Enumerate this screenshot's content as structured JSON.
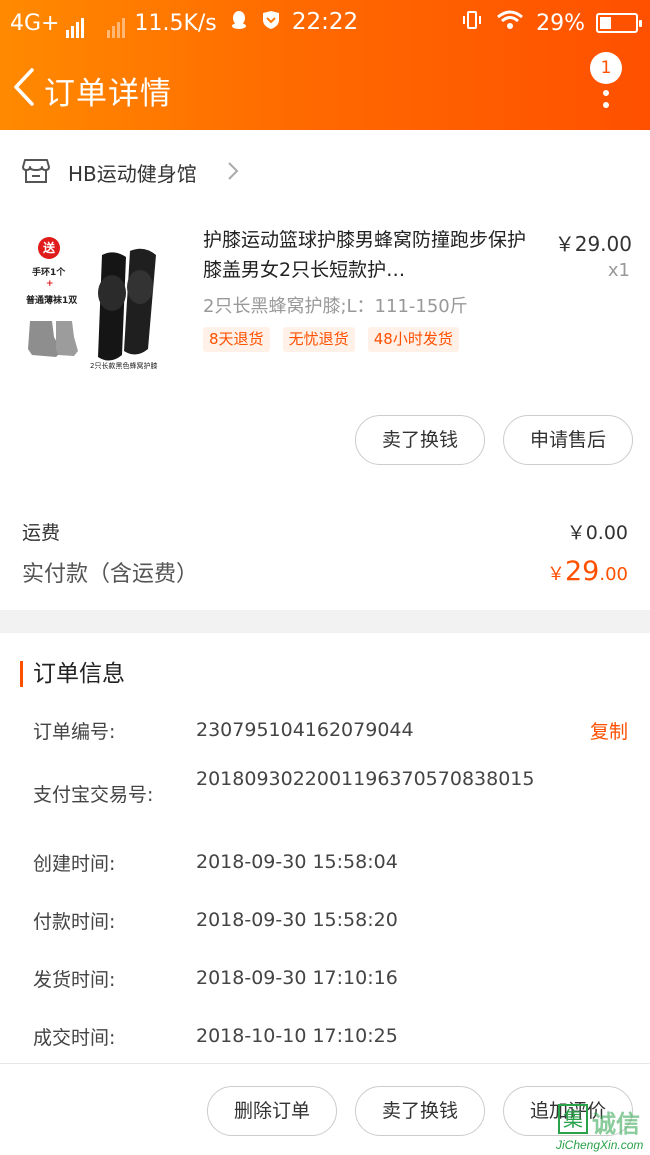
{
  "status_bar": {
    "network": "4G+",
    "speed": "11.5K/s",
    "time": "22:22",
    "battery": "29%"
  },
  "header": {
    "title": "订单详情",
    "badge_count": "1"
  },
  "shop": {
    "name": "HB运动健身馆"
  },
  "product": {
    "title": "护膝运动篮球护膝男蜂窝防撞跑步保护膝盖男女2只长短款护…",
    "price": "￥29.00",
    "quantity": "x1",
    "sku": "2只长黑蜂窝护膝;L：111-150斤",
    "tags": [
      "8天退货",
      "无忧退货",
      "48小时发货"
    ],
    "image_text": {
      "gift_mark": "送",
      "gift_line1": "手环1个",
      "plus": "+",
      "gift_line2": "普通薄袜1双",
      "caption": "2只长款黑色蜂窝护膝"
    }
  },
  "item_actions": {
    "sell": "卖了换钱",
    "after_sale": "申请售后"
  },
  "summary": {
    "shipping_label": "运费",
    "shipping_value": "￥0.00",
    "paid_label": "实付款（含运费）",
    "paid_currency": "￥",
    "paid_int": "29",
    "paid_dec": ".00"
  },
  "order_info": {
    "heading": "订单信息",
    "copy_label": "复制",
    "rows": [
      {
        "label": "订单编号:",
        "value": "230795104162079044"
      },
      {
        "label": "支付宝交易号:",
        "value": "2018093022001196370570838015"
      },
      {
        "label": "创建时间:",
        "value": "2018-09-30 15:58:04"
      },
      {
        "label": "付款时间:",
        "value": "2018-09-30 15:58:20"
      },
      {
        "label": "发货时间:",
        "value": "2018-09-30 17:10:16"
      },
      {
        "label": "成交时间:",
        "value": "2018-10-10 17:10:25"
      }
    ]
  },
  "bottom_actions": {
    "delete": "删除订单",
    "sell": "卖了换钱",
    "review": "追加评价"
  },
  "watermark": {
    "mark": "集",
    "text": "诚信",
    "url": "JiChengXin.com"
  },
  "colors": {
    "accent": "#ff5000",
    "header_gradient_start": "#ff8a00",
    "watermark_green": "#2aa24a"
  }
}
